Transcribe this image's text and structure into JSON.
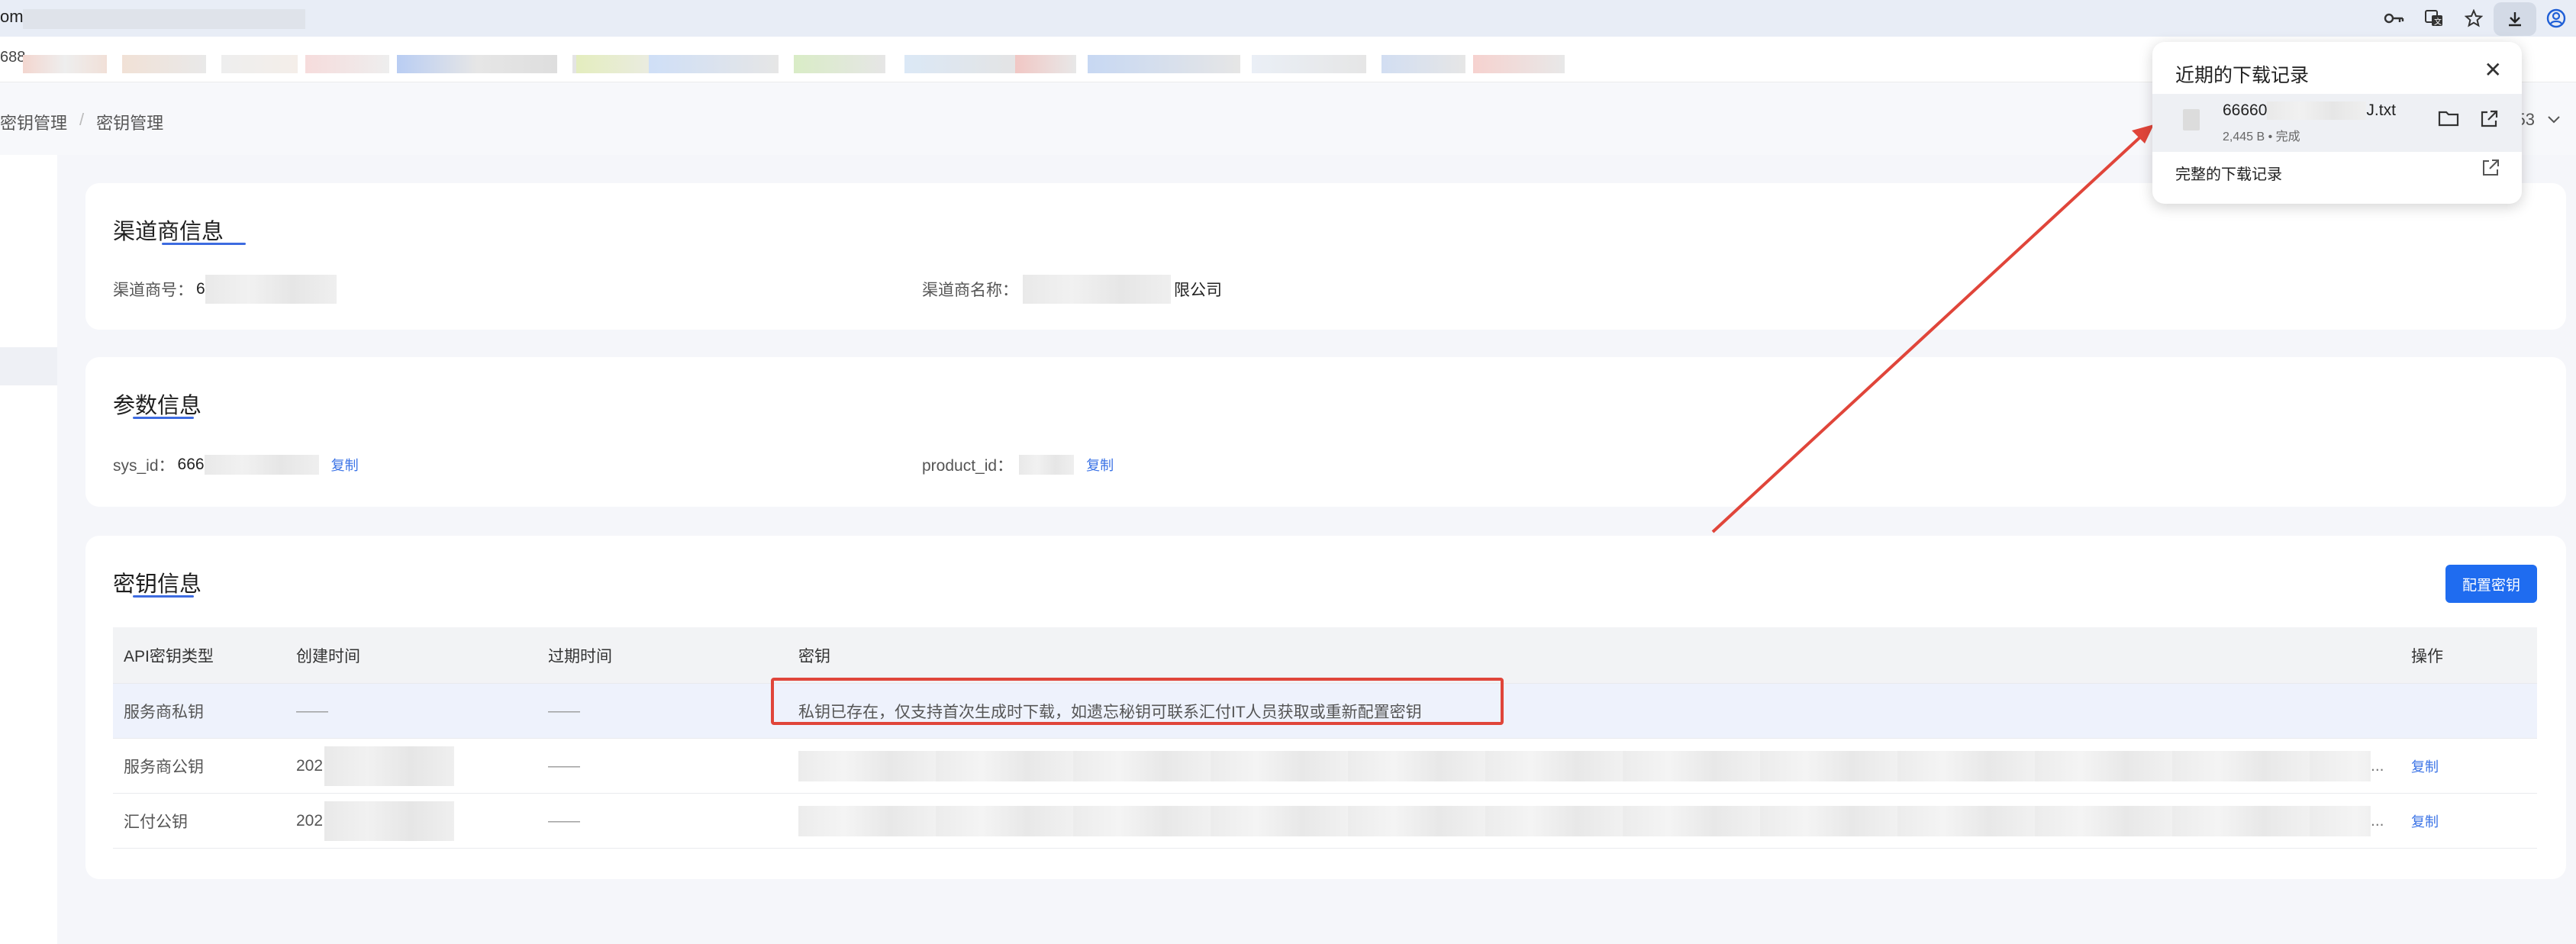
{
  "browser": {
    "url_prefix": "om,",
    "bookmark_prefix": "688"
  },
  "breadcrumb": [
    "密钥管理",
    "密钥管理"
  ],
  "header": {
    "user_suffix": "53"
  },
  "channel_card": {
    "title": "渠道商信息",
    "id_label": "渠道商号：",
    "id_prefix": "6",
    "name_label": "渠道商名称：",
    "name_suffix": "限公司"
  },
  "params_card": {
    "title": "参数信息",
    "sys_id_label": "sys_id：",
    "sys_id_prefix": "666",
    "product_id_label": "product_id：",
    "copy_label": "复制"
  },
  "keys_card": {
    "title": "密钥信息",
    "config_button": "配置密钥",
    "columns": [
      "API密钥类型",
      "创建时间",
      "过期时间",
      "密钥",
      "操作"
    ],
    "rows": [
      {
        "type": "服务商私钥",
        "created": "——",
        "expires": "——",
        "key": "私钥已存在，仅支持首次生成时下载，如遗忘秘钥可联系汇付IT人员获取或重新配置密钥",
        "action": ""
      },
      {
        "type": "服务商公钥",
        "created": "202",
        "expires": "——",
        "key": "",
        "action": "复制"
      },
      {
        "type": "汇付公钥",
        "created": "202",
        "expires": "——",
        "key": "",
        "action": "复制"
      }
    ],
    "ellipsis": "..."
  },
  "downloads": {
    "title": "近期的下载记录",
    "close": "✕",
    "file_name_prefix": "66660",
    "file_name_suffix": "J.txt",
    "file_meta": "2,445 B • 完成",
    "all_label": "完整的下载记录"
  },
  "colors": {
    "primary": "#1f6cf0",
    "annotation_red": "#e0453a",
    "link": "#3b73e6"
  }
}
